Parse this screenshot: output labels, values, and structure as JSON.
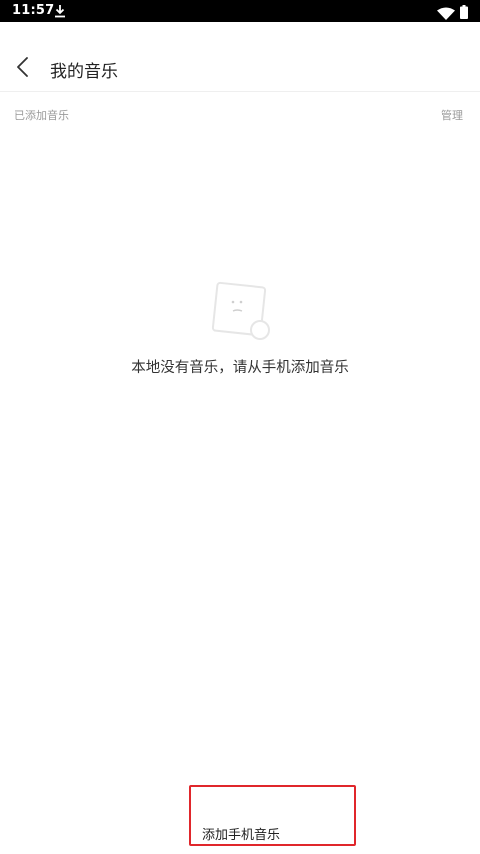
{
  "status_bar": {
    "time": "11:57",
    "icons": [
      "download-icon",
      "wifi-icon",
      "battery-icon"
    ]
  },
  "header": {
    "back_icon": "chevron-left-icon",
    "title": "我的音乐"
  },
  "section": {
    "label": "已添加音乐",
    "manage_label": "管理"
  },
  "empty_state": {
    "icon": "empty-music-icon",
    "message": "本地没有音乐，请从手机添加音乐"
  },
  "action": {
    "add_label": "添加手机音乐",
    "highlight_color": "#e0262b"
  }
}
